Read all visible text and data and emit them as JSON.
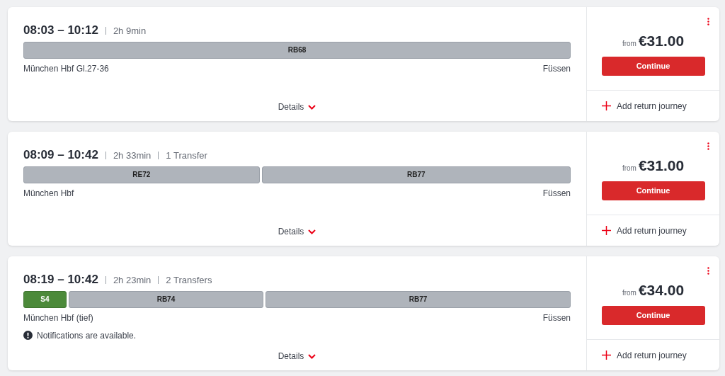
{
  "journeys": [
    {
      "times": "08:03 – 10:12",
      "duration": "2h 9min",
      "segments": [
        {
          "label": "RB68",
          "kind": "regional"
        }
      ],
      "from": "München Hbf Gl.27-36",
      "to": "Füssen",
      "details": "Details",
      "price_prefix": "from",
      "price": "€31.00",
      "continue": "Continue",
      "add_return": "Add return journey"
    },
    {
      "times": "08:09 – 10:42",
      "duration": "2h 33min",
      "transfers": "1 Transfer",
      "segments": [
        {
          "label": "RE72",
          "kind": "regional"
        },
        {
          "label": "RB77",
          "kind": "regional"
        }
      ],
      "from": "München Hbf",
      "to": "Füssen",
      "details": "Details",
      "price_prefix": "from",
      "price": "€31.00",
      "continue": "Continue",
      "add_return": "Add return journey"
    },
    {
      "times": "08:19 – 10:42",
      "duration": "2h 23min",
      "transfers": "2 Transfers",
      "segments": [
        {
          "label": "S4",
          "kind": "sbahn"
        },
        {
          "label": "RB74",
          "kind": "regional"
        },
        {
          "label": "RB77",
          "kind": "regional"
        }
      ],
      "from": "München Hbf (tief)",
      "to": "Füssen",
      "notice": "Notifications are available.",
      "details": "Details",
      "price_prefix": "from",
      "price": "€34.00",
      "continue": "Continue",
      "add_return": "Add return journey"
    }
  ]
}
